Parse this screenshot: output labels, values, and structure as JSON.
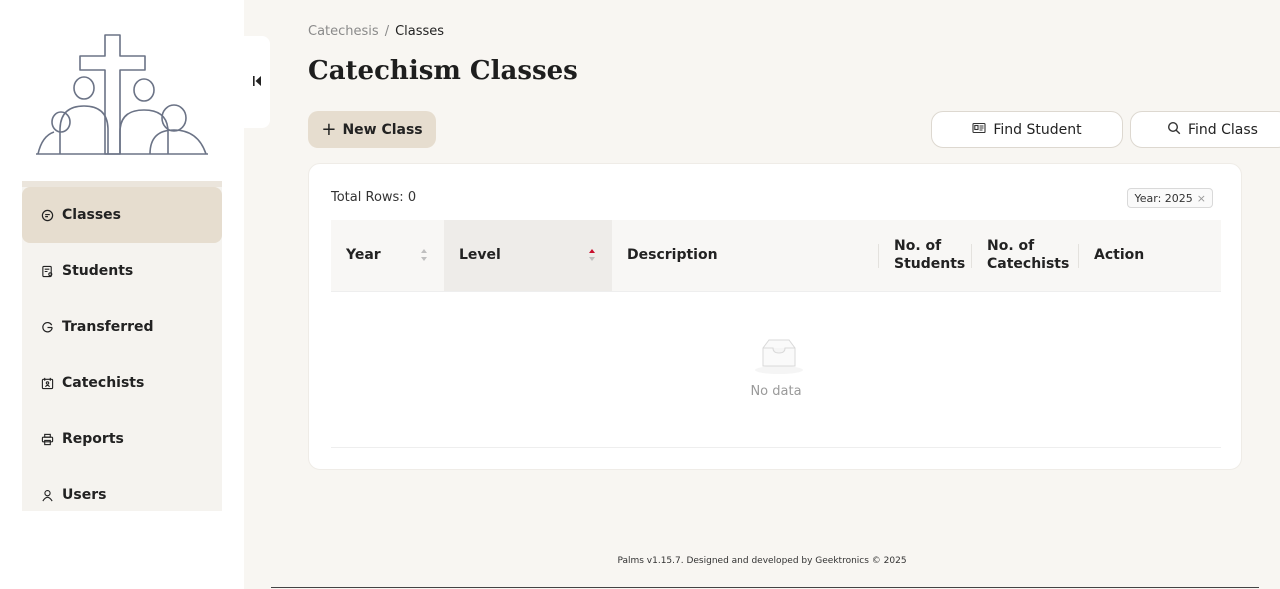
{
  "sidebar": {
    "items": [
      {
        "label": "Classes",
        "icon": "chat-bubble-icon",
        "active": true
      },
      {
        "label": "Students",
        "icon": "student-card-icon",
        "active": false
      },
      {
        "label": "Transferred",
        "icon": "transfer-icon",
        "active": false
      },
      {
        "label": "Catechists",
        "icon": "catechist-icon",
        "active": false
      },
      {
        "label": "Reports",
        "icon": "printer-icon",
        "active": false
      },
      {
        "label": "Users",
        "icon": "user-icon",
        "active": false
      }
    ]
  },
  "breadcrumb": {
    "root": "Catechesis",
    "separator": "/",
    "current": "Classes"
  },
  "page": {
    "title": "Catechism Classes"
  },
  "toolbar": {
    "new_class_label": "New Class",
    "find_student_label": "Find Student",
    "find_class_label": "Find Class"
  },
  "table": {
    "total_rows_label": "Total Rows: 0",
    "filter_tag": "Year: 2025",
    "columns": [
      {
        "label": "Year",
        "sortable": true
      },
      {
        "label": "Level",
        "sortable": true,
        "sorted": "ascending"
      },
      {
        "label": "Description",
        "sortable": false
      },
      {
        "label": "No. of Students",
        "sortable": false
      },
      {
        "label": "No. of Catechists",
        "sortable": false
      },
      {
        "label": "Action",
        "sortable": false
      }
    ],
    "rows": [],
    "empty_text": "No data"
  },
  "footer": {
    "text": "Palms v1.15.7. Designed and developed by Geektronics © 2025"
  },
  "colors": {
    "accent": "#e6ddcf",
    "sort_active": "#c8102e",
    "logo_stroke": "#6b7386"
  }
}
